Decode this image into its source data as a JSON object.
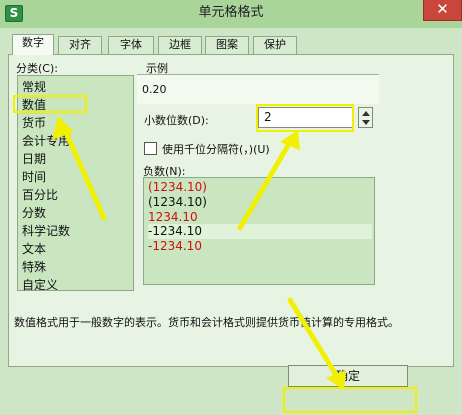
{
  "window": {
    "title": "单元格格式",
    "app_logo": "S",
    "close_glyph": "✕"
  },
  "tabs": [
    {
      "label": "数字",
      "active": true
    },
    {
      "label": "对齐"
    },
    {
      "label": "字体"
    },
    {
      "label": "边框"
    },
    {
      "label": "图案"
    },
    {
      "label": "保护"
    }
  ],
  "category": {
    "label": "分类(C):",
    "items": [
      "常规",
      "数值",
      "货币",
      "会计专用",
      "日期",
      "时间",
      "百分比",
      "分数",
      "科学记数",
      "文本",
      "特殊",
      "自定义"
    ],
    "selected": "数值"
  },
  "sample": {
    "label": "示例",
    "value": "0.20"
  },
  "decimal": {
    "label": "小数位数(D):",
    "value": "2"
  },
  "thousands": {
    "label": "使用千位分隔符(，)(U)",
    "checked": false
  },
  "negative": {
    "label": "负数(N):",
    "items": [
      {
        "text": "(1234.10)",
        "color": "#d01010"
      },
      {
        "text": "(1234.10)",
        "color": "#111111"
      },
      {
        "text": "1234.10",
        "color": "#d01010"
      },
      {
        "text": "-1234.10",
        "color": "#111111"
      },
      {
        "text": "-1234.10",
        "color": "#d01010"
      }
    ]
  },
  "description": "数值格式用于一般数字的表示。货币和会计格式则提供货币值计算的专用格式。",
  "buttons": {
    "ok": "确定"
  },
  "colors": {
    "highlight": "#f0f000",
    "negative_red": "#d01010",
    "close": "#c8463b",
    "titlebar": "#a9d59a"
  },
  "icons": {
    "logo": "wps-spreadsheet-logo",
    "close": "close-icon",
    "spin_up": "spin-up-icon",
    "spin_down": "spin-down-icon",
    "checkbox": "checkbox-icon"
  }
}
